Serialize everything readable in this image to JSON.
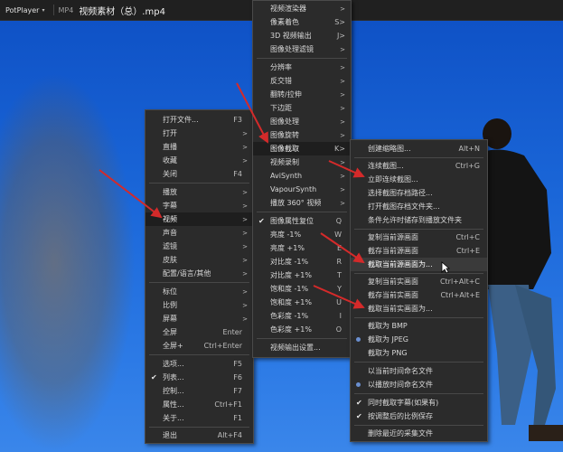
{
  "titlebar": {
    "app": "PotPlayer",
    "dropdown": "▾",
    "format": "MP4",
    "title": "视频素材（总）.mp4"
  },
  "menu_main": {
    "items": [
      {
        "label": "打开文件...",
        "shortcut": "F3"
      },
      {
        "label": "打开",
        "arrow": ">"
      },
      {
        "label": "直播",
        "arrow": ">"
      },
      {
        "label": "收藏",
        "arrow": ">"
      },
      {
        "label": "关闭",
        "shortcut": "F4"
      },
      {
        "label": "播放",
        "arrow": ">"
      },
      {
        "label": "字幕",
        "arrow": ">"
      },
      {
        "label": "视频",
        "arrow": ">"
      },
      {
        "label": "声音",
        "arrow": ">"
      },
      {
        "label": "滤镜",
        "arrow": ">"
      },
      {
        "label": "皮肤",
        "arrow": ">"
      },
      {
        "label": "配置/语言/其他",
        "arrow": ">"
      },
      {
        "label": "标位",
        "arrow": ">"
      },
      {
        "label": "比例",
        "arrow": ">"
      },
      {
        "label": "屏幕",
        "arrow": ">"
      },
      {
        "label": "全屏",
        "shortcut": "Enter"
      },
      {
        "label": "全屏+",
        "shortcut": "Ctrl+Enter"
      },
      {
        "label": "选项...",
        "shortcut": "F5"
      },
      {
        "label": "列表...",
        "shortcut": "F6"
      },
      {
        "label": "控制...",
        "shortcut": "F7"
      },
      {
        "label": "属性...",
        "shortcut": "Ctrl+F1"
      },
      {
        "label": "关于...",
        "shortcut": "F1"
      },
      {
        "label": "退出",
        "shortcut": "Alt+F4"
      }
    ]
  },
  "menu_video": {
    "items": [
      {
        "label": "视频渲染器",
        "arrow": ">"
      },
      {
        "label": "像素着色",
        "shortcut": "S>"
      },
      {
        "label": "3D 视频输出",
        "shortcut": "J>"
      },
      {
        "label": "图像处理滤镜",
        "arrow": ">"
      },
      {
        "label": "分辨率",
        "arrow": ">"
      },
      {
        "label": "反交错",
        "arrow": ">"
      },
      {
        "label": "翻转/拉伸",
        "arrow": ">"
      },
      {
        "label": "下边距",
        "arrow": ">"
      },
      {
        "label": "图像处理",
        "arrow": ">"
      },
      {
        "label": "图像旋转",
        "arrow": ">"
      },
      {
        "label": "图像截取",
        "shortcut": "K>"
      },
      {
        "label": "视频录制",
        "arrow": ">"
      },
      {
        "label": "AviSynth",
        "arrow": ">"
      },
      {
        "label": "VapourSynth",
        "arrow": ">"
      },
      {
        "label": "播放 360° 视频",
        "arrow": ">"
      },
      {
        "label": "图像属性复位",
        "shortcut": "Q"
      },
      {
        "label": "亮度 -1%",
        "shortcut": "W"
      },
      {
        "label": "亮度 +1%",
        "shortcut": "E"
      },
      {
        "label": "对比度 -1%",
        "shortcut": "R"
      },
      {
        "label": "对比度 +1%",
        "shortcut": "T"
      },
      {
        "label": "饱和度 -1%",
        "shortcut": "Y"
      },
      {
        "label": "饱和度 +1%",
        "shortcut": "U"
      },
      {
        "label": "色彩度 -1%",
        "shortcut": "I"
      },
      {
        "label": "色彩度 +1%",
        "shortcut": "O"
      },
      {
        "label": "视频输出设置..."
      }
    ]
  },
  "menu_capture": {
    "items": [
      {
        "label": "创建缩略图...",
        "shortcut": "Alt+N"
      },
      {
        "label": "连续截图...",
        "shortcut": "Ctrl+G"
      },
      {
        "label": "立即连续截图..."
      },
      {
        "label": "选择截图存档路径..."
      },
      {
        "label": "打开截图存档文件夹..."
      },
      {
        "label": "条件允许时储存到播放文件夹"
      },
      {
        "label": "复制当前源画面",
        "shortcut": "Ctrl+C"
      },
      {
        "label": "截存当前源画面",
        "shortcut": "Ctrl+E"
      },
      {
        "label": "截取当前源画面为..."
      },
      {
        "label": "复制当前实画面",
        "shortcut": "Ctrl+Alt+C"
      },
      {
        "label": "截存当前实画面",
        "shortcut": "Ctrl+Alt+E"
      },
      {
        "label": "截取当前实画面为..."
      },
      {
        "label": "截取为 BMP"
      },
      {
        "label": "截取为 JPEG"
      },
      {
        "label": "截取为 PNG"
      },
      {
        "label": "以当前时间命名文件"
      },
      {
        "label": "以播放时间命名文件"
      },
      {
        "label": "同时截取字幕(如果有)"
      },
      {
        "label": "按调整后的比例保存"
      },
      {
        "label": "删除最近的采集文件"
      }
    ]
  },
  "colors": {
    "arrow_red": "#d42a2a",
    "sky": "#1a66d8",
    "menu_bg": "#2b2b2b"
  }
}
